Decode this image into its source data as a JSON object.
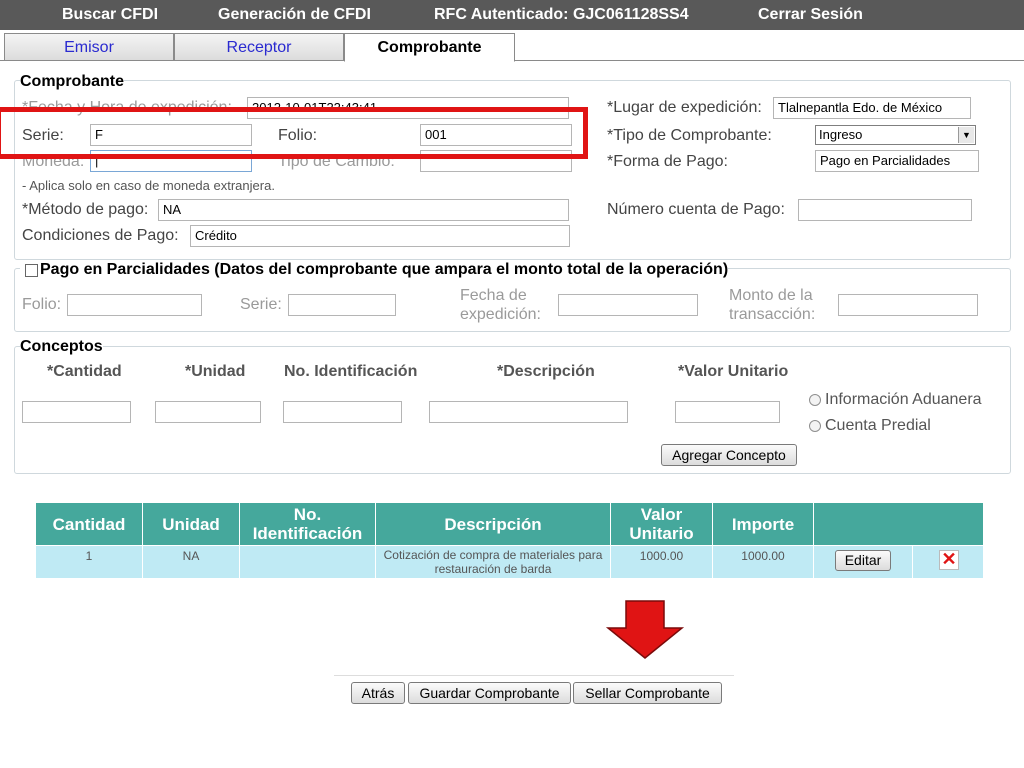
{
  "nav": {
    "buscar": "Buscar CFDI",
    "generacion": "Generación de CFDI",
    "rfc": "RFC Autenticado: GJC061128SS4",
    "cerrar": "Cerrar Sesión"
  },
  "tabs": {
    "emisor": "Emisor",
    "receptor": "Receptor",
    "comprobante": "Comprobante"
  },
  "comprobante": {
    "legend": "Comprobante",
    "fecha_label": "*Fecha y Hora de expedición:",
    "fecha_value": "2012-10-01T22:43:41",
    "serie_label": "Serie:",
    "serie_value": "F",
    "folio_label": "Folio:",
    "folio_value": "001",
    "moneda_label": "Moneda:",
    "moneda_value": "|",
    "tipo_cambio_label": "Tipo de Cambio:",
    "nota": "- Aplica solo en caso de moneda extranjera.",
    "metodo_label": "*Método de pago:",
    "metodo_value": "NA",
    "condiciones_label": "Condiciones de Pago:",
    "condiciones_value": "Crédito",
    "lugar_label": "*Lugar de expedición:",
    "lugar_value": "Tlalnepantla Edo. de México",
    "tipo_label": "*Tipo de Comprobante:",
    "tipo_value": "Ingreso",
    "forma_label": "*Forma de Pago:",
    "forma_value": "Pago en Parcialidades",
    "cuenta_label": "Número cuenta de Pago:"
  },
  "parcialidades": {
    "legend": "Pago en Parcialidades (Datos del comprobante que ampara el monto total de la operación)",
    "folio_label": "Folio:",
    "serie_label": "Serie:",
    "fecha_label_1": "Fecha de",
    "fecha_label_2": "expedición:",
    "monto_label_1": "Monto de la",
    "monto_label_2": "transacción:"
  },
  "conceptos": {
    "legend": "Conceptos",
    "cantidad": "*Cantidad",
    "unidad": "*Unidad",
    "no_id": "No. Identificación",
    "descripcion": "*Descripción",
    "valor": "*Valor Unitario",
    "radio_aduanera": "Información Aduanera",
    "radio_predial": "Cuenta Predial",
    "agregar": "Agregar Concepto"
  },
  "table": {
    "headers": {
      "cantidad": "Cantidad",
      "unidad": "Unidad",
      "no_id_1": "No.",
      "no_id_2": "Identificación",
      "descripcion": "Descripción",
      "valor_1": "Valor",
      "valor_2": "Unitario",
      "importe": "Importe"
    },
    "rows": [
      {
        "cantidad": "1",
        "unidad": "NA",
        "no_id": "",
        "descripcion": "Cotización de compra de materiales para restauración de barda",
        "valor": "1000.00",
        "importe": "1000.00",
        "editar": "Editar"
      }
    ]
  },
  "actions": {
    "atras": "Atrás",
    "guardar": "Guardar Comprobante",
    "sellar": "Sellar Comprobante"
  },
  "colors": {
    "nav": "#595959",
    "table_header": "#45a89c",
    "table_row": "#bfeaf4",
    "highlight": "#e01414"
  }
}
